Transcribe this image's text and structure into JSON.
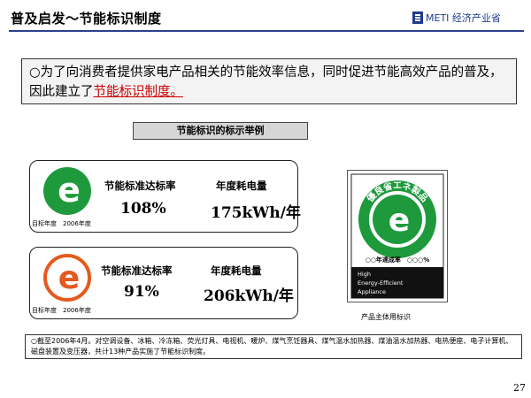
{
  "header": {
    "title": "普及启发～节能标识制度",
    "logo_latin": "METI",
    "logo_cjk": "经济产业省"
  },
  "intro": {
    "text_before": "○为了向消费者提供家电产品相关的节能效率信息，同时促进节能高效产品的普及，因此建立了",
    "text_highlight": "节能标识制度。"
  },
  "caption": "节能标识的标示举例",
  "labels": [
    {
      "color": "#1e9a3c",
      "rate_heading": "节能标准达标率",
      "rate_value": "108%",
      "energy_heading": "年度耗电量",
      "energy_value": "175kWh/年",
      "target_year": "目标年度　2006年度"
    },
    {
      "color": "#e55a1c",
      "rate_heading": "节能标准达标率",
      "rate_value": "91%",
      "energy_heading": "年度耗电量",
      "energy_value": "206kWh/年",
      "target_year": "目标年度　2006年度"
    }
  ],
  "product_label": {
    "title": "優良省エネ製品",
    "rate_line": "○○年達成率　○○○%",
    "line1": "High",
    "line2": "Energy-Efficient",
    "line3": "Appliance",
    "caption": "产品主体用标识",
    "color": "#1e9a3c"
  },
  "note": "○截至2006年4月。对空调设备、冰箱、冷冻箱、荧光灯具、电视机、暖炉、煤气烹饪器具、煤气温水加热器、煤油温水加热器、电热便座、电子计算机、磁盘装置及变压器，共计13种产品实施了节能标识制度。",
  "page_number": "27"
}
